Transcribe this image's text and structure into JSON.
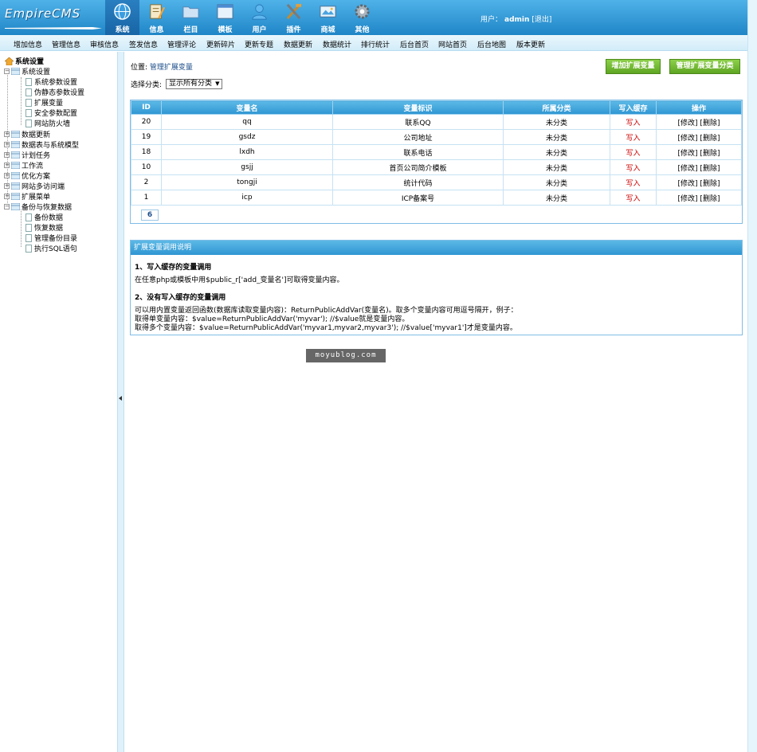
{
  "app": {
    "logo": "EmpireCMS"
  },
  "topnav": [
    {
      "label": "系统",
      "icon": "globe-icon",
      "active": true
    },
    {
      "label": "信息",
      "icon": "notepad-icon"
    },
    {
      "label": "栏目",
      "icon": "folder-icon"
    },
    {
      "label": "模板",
      "icon": "window-icon"
    },
    {
      "label": "用户",
      "icon": "user-icon"
    },
    {
      "label": "插件",
      "icon": "tools-icon"
    },
    {
      "label": "商城",
      "icon": "shop-icon"
    },
    {
      "label": "其他",
      "icon": "gear-icon"
    }
  ],
  "user": {
    "prefix": "用户：",
    "name": "admin",
    "logout": "[退出]"
  },
  "submenu": [
    "增加信息",
    "管理信息",
    "审核信息",
    "签发信息",
    "管理评论",
    "更新碎片",
    "更新专题",
    "数据更新",
    "数据统计",
    "排行统计",
    "后台首页",
    "网站首页",
    "后台地图",
    "版本更新"
  ],
  "sidebar": {
    "root": "系统设置",
    "items": [
      {
        "label": "系统设置",
        "type": "folder-open"
      },
      {
        "label": "系统参数设置",
        "type": "doc"
      },
      {
        "label": "伪静态参数设置",
        "type": "doc"
      },
      {
        "label": "扩展变量",
        "type": "doc"
      },
      {
        "label": "安全参数配置",
        "type": "doc"
      },
      {
        "label": "网站防火墙",
        "type": "doc"
      },
      {
        "label": "数据更新",
        "type": "folder"
      },
      {
        "label": "数据表与系统模型",
        "type": "folder"
      },
      {
        "label": "计划任务",
        "type": "folder"
      },
      {
        "label": "工作流",
        "type": "folder"
      },
      {
        "label": "优化方案",
        "type": "folder"
      },
      {
        "label": "网站多访问端",
        "type": "folder"
      },
      {
        "label": "扩展菜单",
        "type": "folder"
      },
      {
        "label": "备份与恢复数据",
        "type": "folder-open"
      },
      {
        "label": "备份数据",
        "type": "doc"
      },
      {
        "label": "恢复数据",
        "type": "doc"
      },
      {
        "label": "管理备份目录",
        "type": "doc"
      },
      {
        "label": "执行SQL语句",
        "type": "doc"
      }
    ]
  },
  "main": {
    "location_prefix": "位置: ",
    "location_link": "管理扩展变量",
    "btn_add": "增加扩展变量",
    "btn_manage_class": "管理扩展变量分类",
    "filter_label": "选择分类:",
    "filter_value": "显示所有分类",
    "table": {
      "headers": [
        "ID",
        "变量名",
        "变量标识",
        "所属分类",
        "写入缓存",
        "操作"
      ],
      "rows": [
        {
          "id": "20",
          "name": "qq",
          "label": "联系QQ",
          "cat": "未分类",
          "cache": "写入",
          "ops": "[修改] [删除]"
        },
        {
          "id": "19",
          "name": "gsdz",
          "label": "公司地址",
          "cat": "未分类",
          "cache": "写入",
          "ops": "[修改] [删除]"
        },
        {
          "id": "18",
          "name": "lxdh",
          "label": "联系电话",
          "cat": "未分类",
          "cache": "写入",
          "ops": "[修改] [删除]"
        },
        {
          "id": "10",
          "name": "gsjj",
          "label": "首页公司简介模板",
          "cat": "未分类",
          "cache": "写入",
          "ops": "[修改] [删除]"
        },
        {
          "id": "2",
          "name": "tongji",
          "label": "统计代码",
          "cat": "未分类",
          "cache": "写入",
          "ops": "[修改] [删除]"
        },
        {
          "id": "1",
          "name": "icp",
          "label": "ICP备案号",
          "cat": "未分类",
          "cache": "写入",
          "ops": "[修改] [删除]"
        }
      ],
      "total": "6"
    },
    "help": {
      "title": "扩展变量调用说明",
      "s1_title": "1、写入缓存的变量调用",
      "s1_text": "在任意php或模板中用$public_r['add_变量名']可取得变量内容。",
      "s2_title": "2、没有写入缓存的变量调用",
      "s2_line1": "可以用内置变量返回函数(数据库读取变量内容)：ReturnPublicAddVar(变量名)。取多个变量内容可用逗号隔开，例子：",
      "s2_line2": "取得单变量内容：$value=ReturnPublicAddVar('myvar'); //$value就是变量内容。",
      "s2_line3": "取得多个变量内容：$value=ReturnPublicAddVar('myvar1,myvar2,myvar3'); //$value['myvar1']才是变量内容。"
    }
  },
  "watermark": "moyublog.com"
}
